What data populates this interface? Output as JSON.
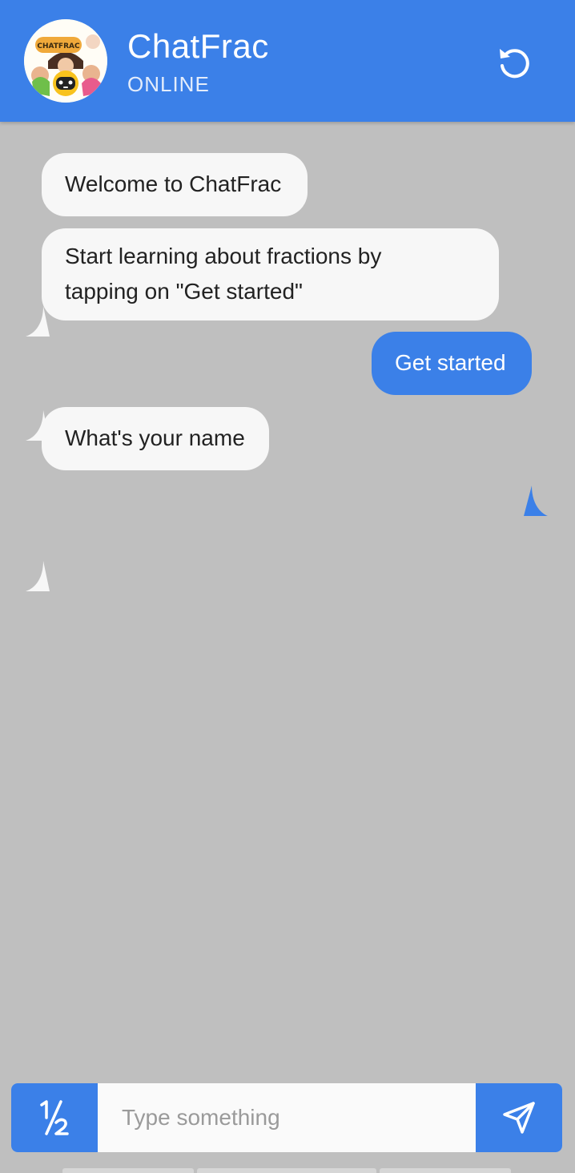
{
  "header": {
    "title": "ChatFrac",
    "status": "ONLINE",
    "avatar_logo_text": "CHATFRAC",
    "reset_icon": "refresh-icon"
  },
  "messages": [
    {
      "sender": "bot",
      "text": "Welcome to ChatFrac"
    },
    {
      "sender": "bot",
      "text_lines": [
        "Start learning about fractions by",
        "tapping on \"Get started\""
      ]
    },
    {
      "sender": "user",
      "text": "Get started"
    },
    {
      "sender": "bot",
      "text": "What's your name"
    }
  ],
  "composer": {
    "fraction_icon": "fraction-half-icon",
    "placeholder": "Type something",
    "value": "",
    "send_icon": "send-icon"
  },
  "colors": {
    "accent": "#3b80e8",
    "background": "#bfbfbf",
    "bot_bubble": "#f7f7f7",
    "user_text": "#ffffff"
  }
}
